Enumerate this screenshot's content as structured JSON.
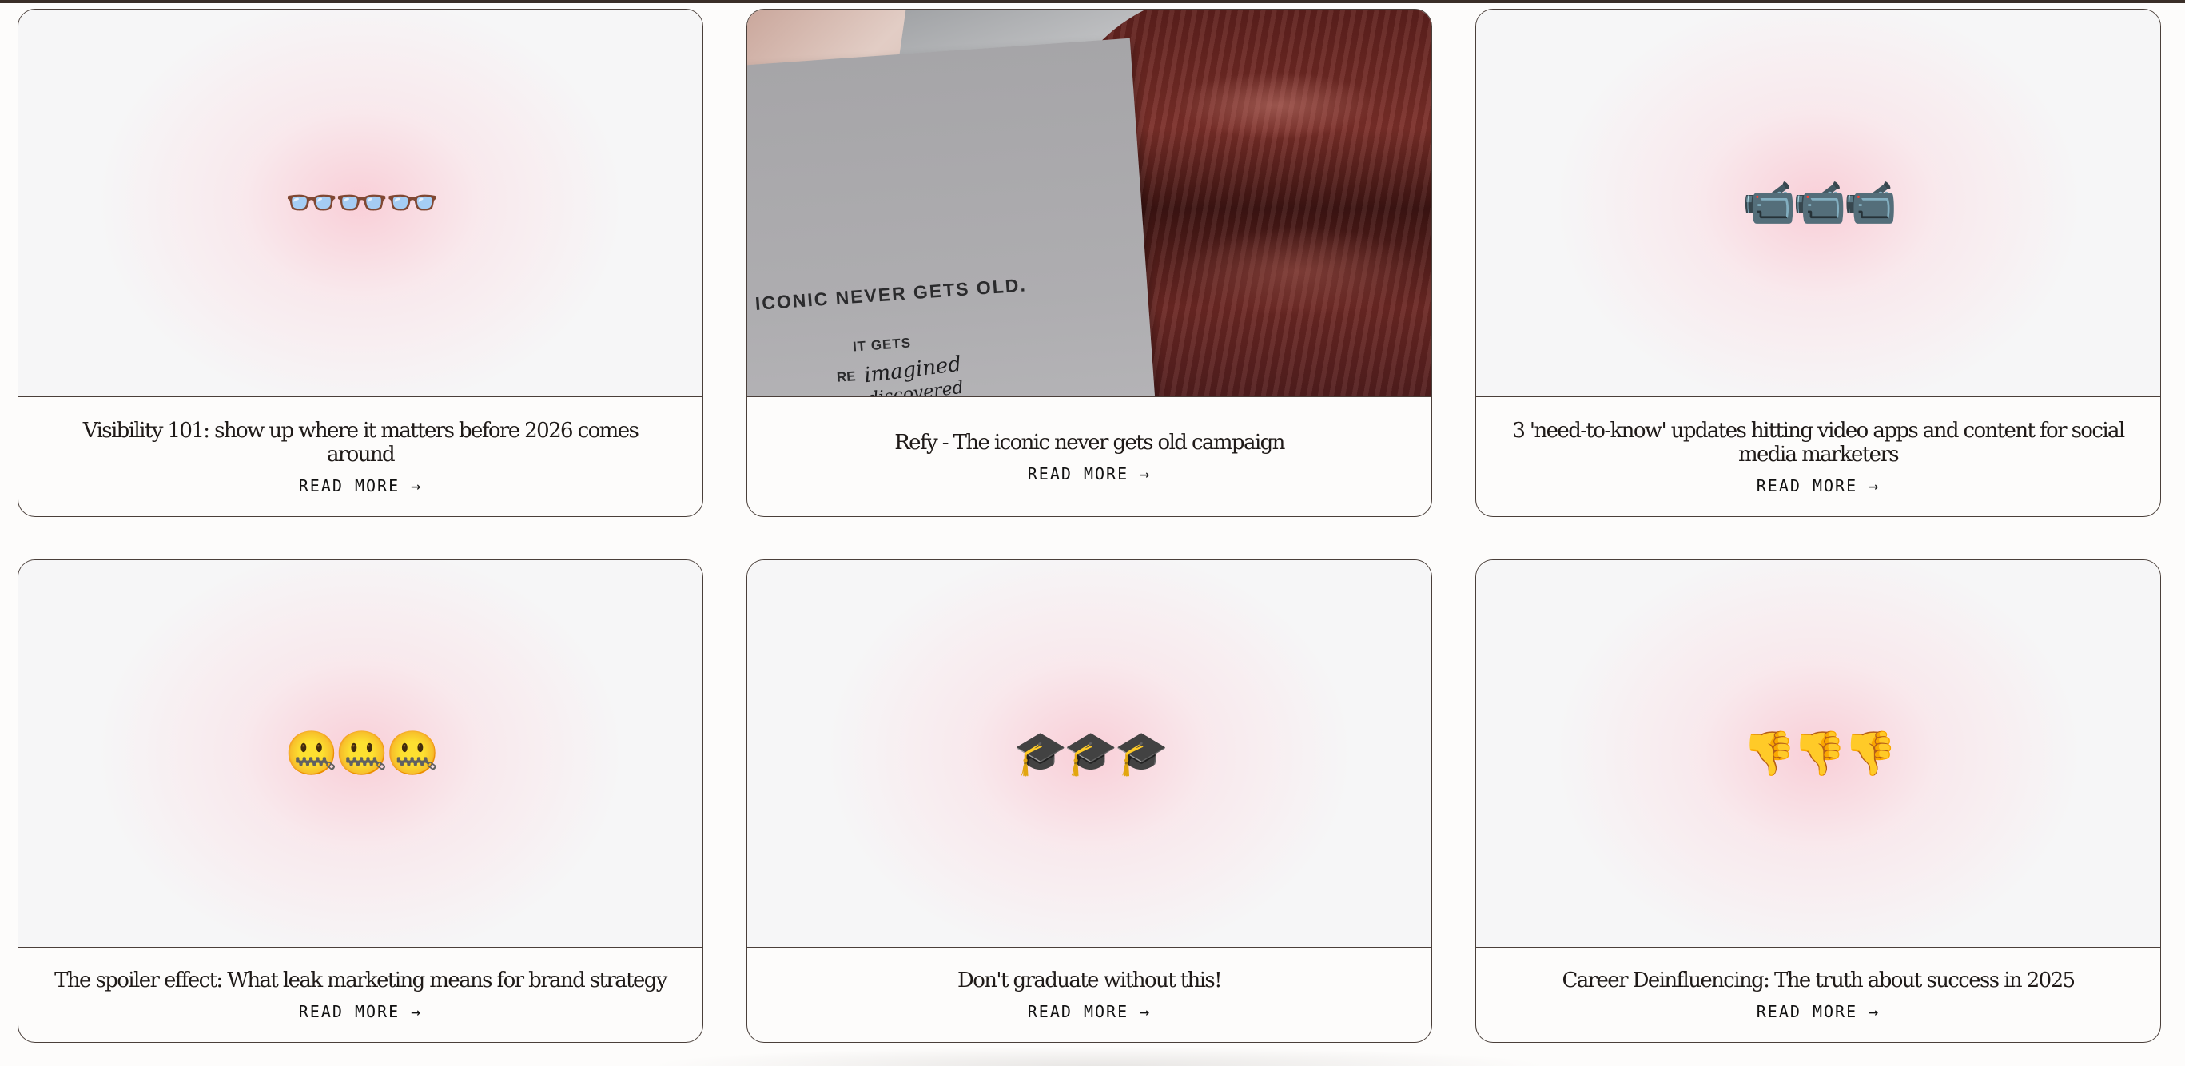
{
  "posts": [
    {
      "title": "Visibility 101: show up where it matters before 2026 comes around",
      "emoji": "👓👓👓",
      "read_more": "READ MORE →"
    },
    {
      "title": "Refy - The iconic never gets old campaign",
      "image": {
        "line1": "ICONIC NEVER GETS OLD.",
        "line2": "IT GETS",
        "line3": "RE",
        "script1": "imagined",
        "script2": "discovered"
      },
      "read_more": "READ MORE →"
    },
    {
      "title": "3 'need-to-know' updates hitting video apps and content for social media marketers",
      "emoji": "📹📹📹",
      "read_more": "READ MORE →"
    },
    {
      "title": "The spoiler effect: What leak marketing means for brand strategy",
      "emoji": "🤐🤐🤐",
      "read_more": "READ MORE →"
    },
    {
      "title": "Don't graduate without this!",
      "emoji": "🎓🎓🎓",
      "read_more": "READ MORE →"
    },
    {
      "title": "Career Deinfluencing: The truth about success in 2025",
      "emoji": "👎👎👎",
      "read_more": "READ MORE →"
    }
  ]
}
